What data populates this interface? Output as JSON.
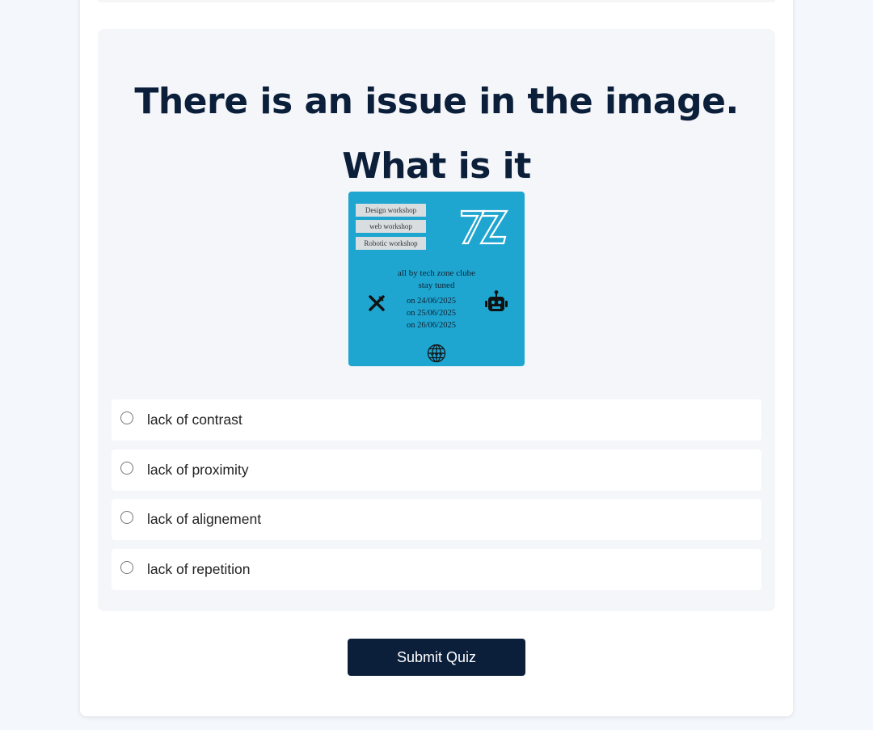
{
  "question": {
    "title_line1": "There is an issue in the image.",
    "title_line2": "What is it"
  },
  "poster": {
    "tags": [
      "Design workshop",
      "web workshop",
      "Robotic workshop"
    ],
    "logo_text": "TZ",
    "line1": "all by tech zone clube",
    "line2": "stay tuned",
    "dates": [
      "on 24/06/2025",
      "on 25/06/2025",
      "on 26/06/2025"
    ],
    "globe_text": "www",
    "background_color": "#1ea5d0",
    "icons": [
      "design-tools-icon",
      "robot-icon",
      "globe-icon"
    ]
  },
  "options": [
    {
      "label": "lack of contrast",
      "selected": false
    },
    {
      "label": "lack of proximity",
      "selected": false
    },
    {
      "label": "lack of alignement",
      "selected": false
    },
    {
      "label": "lack of repetition",
      "selected": false
    }
  ],
  "submit_label": "Submit Quiz",
  "colors": {
    "primary": "#0b1f3a",
    "page_background": "#f4f7fb",
    "question_background": "#f4f6f9"
  }
}
